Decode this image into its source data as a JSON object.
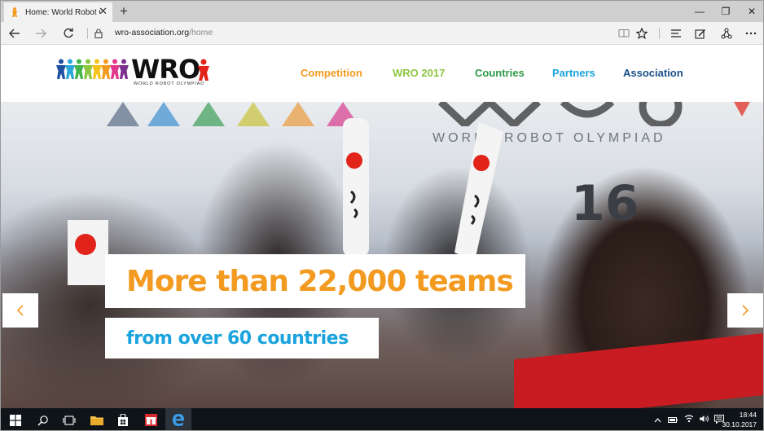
{
  "browser": {
    "tab_title": "Home: World Robot Oly",
    "new_tab": "+",
    "tab_close": "✕",
    "url_host": "wro-association.org",
    "url_path": "/home",
    "window_controls": {
      "minimize": "—",
      "restore": "❐",
      "close": "✕"
    }
  },
  "site": {
    "logo_text": "WRO",
    "logo_subtitle": "WORLD ROBOT OLYMPIAD",
    "logo_people_colors": [
      "#1f4fa2",
      "#2aa7d8",
      "#43b54a",
      "#8cc63f",
      "#f7c21b",
      "#f39a20",
      "#e2378b",
      "#7b2f8f"
    ],
    "nav": [
      {
        "label": "Competition",
        "color": "#f39a20"
      },
      {
        "label": "WRO 2017",
        "color": "#8cc63f"
      },
      {
        "label": "Countries",
        "color": "#2e9a46"
      },
      {
        "label": "Partners",
        "color": "#1aa3dc"
      },
      {
        "label": "Association",
        "color": "#1a4f8a"
      }
    ]
  },
  "hero": {
    "banner_text": "WORLD ROBOT OLYMPIAD",
    "year_text": "16",
    "headline": "More than 22,000 teams",
    "subheadline": "from over 60 countries",
    "headline_color": "#f39a20",
    "subheadline_color": "#1aa3dc",
    "arrow_prev": "‹",
    "arrow_next": "›"
  },
  "taskbar": {
    "time": "18:44",
    "date": "30.10.2017"
  }
}
